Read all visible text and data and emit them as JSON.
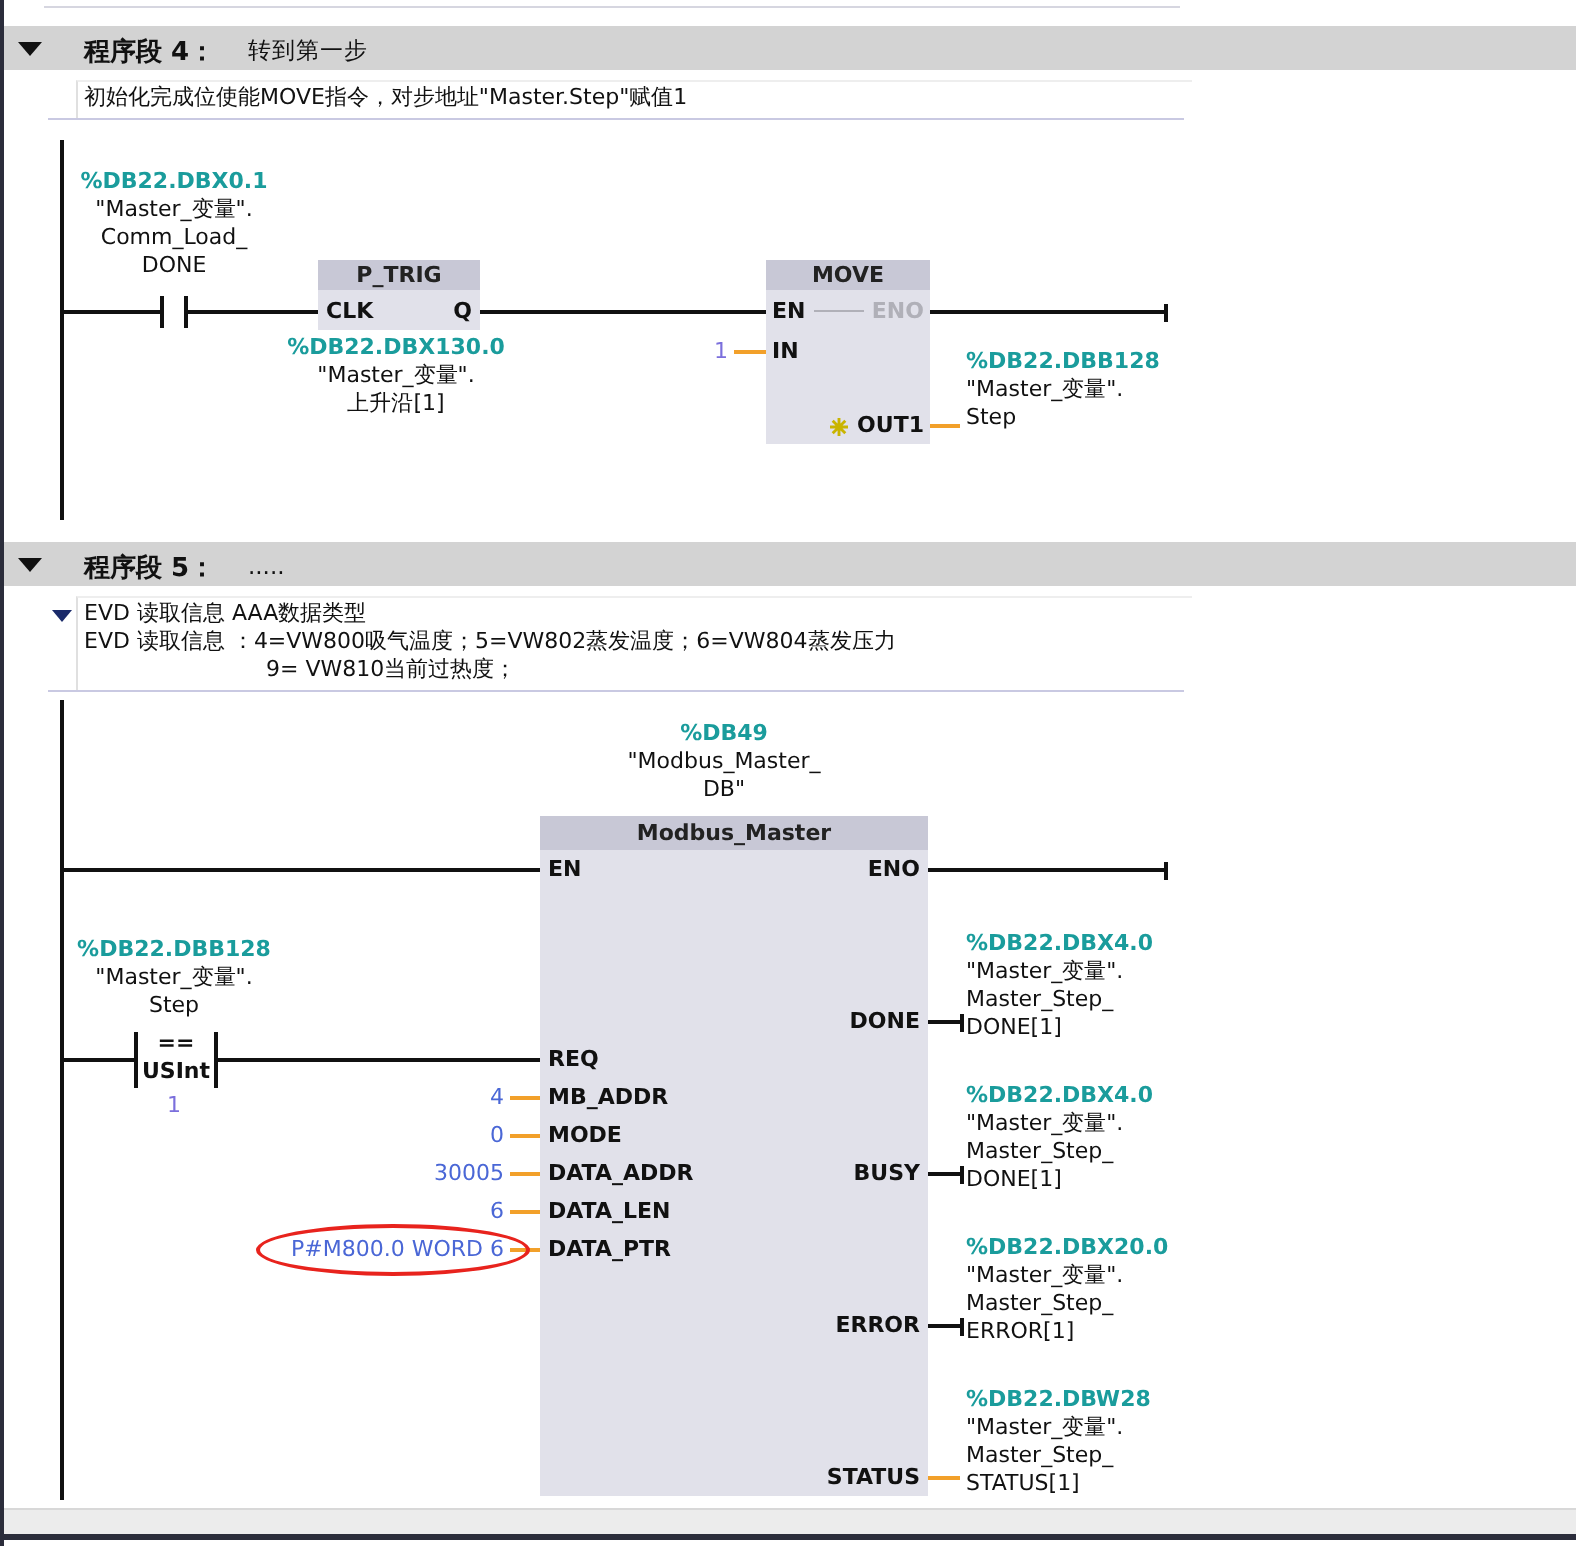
{
  "networks": [
    {
      "title": "程序段 4：",
      "subtitle": "转到第一步",
      "expanded": true,
      "comment": [
        "初始化完成位使能MOVE指令，对步地址\"Master.Step\"赋值1"
      ],
      "diagram": {
        "kind": "move",
        "contact": {
          "address": "%DB22.DBX0.1",
          "tag": [
            "\"Master_变量\".",
            "Comm_Load_",
            "DONE"
          ]
        },
        "edge_block": {
          "title": "P_TRIG",
          "input": "CLK",
          "output": "Q",
          "address": "%DB22.DBX130.0",
          "tag": [
            "\"Master_变量\".",
            "上升沿[1]"
          ]
        },
        "move_block": {
          "title": "MOVE",
          "en": "EN",
          "eno": "ENO",
          "eno_enabled": false,
          "input": {
            "pin": "IN",
            "value": "1"
          },
          "output": {
            "pin": "OUT1",
            "address": "%DB22.DBB128",
            "tag": [
              "\"Master_变量\".",
              "Step"
            ]
          }
        }
      }
    },
    {
      "title": "程序段 5：",
      "subtitle": ".....",
      "expanded": true,
      "comment_expanded": true,
      "comment": [
        "EVD 读取信息  AAA数据类型",
        "EVD 读取信息 ：4=VW800吸气温度；5=VW802蒸发温度；6=VW804蒸发压力",
        "9= VW810当前过热度；"
      ],
      "diagram": {
        "kind": "call",
        "instance": {
          "address": "%DB49",
          "tag": [
            "\"Modbus_Master_",
            "DB\""
          ]
        },
        "block": {
          "title": "Modbus_Master",
          "en": "EN",
          "eno": "ENO"
        },
        "compare": {
          "address": "%DB22.DBB128",
          "tag": [
            "\"Master_变量\".",
            "Step"
          ],
          "operator": "==",
          "type": "USInt",
          "value": "1"
        },
        "inputs": [
          {
            "pin": "REQ",
            "highlighted": false
          },
          {
            "pin": "MB_ADDR",
            "value": "4",
            "highlighted": false
          },
          {
            "pin": "MODE",
            "value": "0",
            "highlighted": false
          },
          {
            "pin": "DATA_ADDR",
            "value": "30005",
            "highlighted": false
          },
          {
            "pin": "DATA_LEN",
            "value": "6",
            "highlighted": false
          },
          {
            "pin": "DATA_PTR",
            "value": "P#M800.0 WORD 6",
            "highlighted": true
          }
        ],
        "outputs": [
          {
            "pin": "DONE",
            "kind": "bool",
            "address": "%DB22.DBX4.0",
            "tag": [
              "\"Master_变量\".",
              "Master_Step_",
              "DONE[1]"
            ]
          },
          {
            "pin": "BUSY",
            "kind": "bool",
            "address": "%DB22.DBX4.0",
            "tag": [
              "\"Master_变量\".",
              "Master_Step_",
              "DONE[1]"
            ]
          },
          {
            "pin": "ERROR",
            "kind": "bool",
            "address": "%DB22.DBX20.0",
            "tag": [
              "\"Master_变量\".",
              "Master_Step_",
              "ERROR[1]"
            ]
          },
          {
            "pin": "STATUS",
            "kind": "word",
            "address": "%DB22.DBW28",
            "tag": [
              "\"Master_变量\".",
              "Master_Step_",
              "STATUS[1]"
            ]
          }
        ]
      }
    }
  ]
}
